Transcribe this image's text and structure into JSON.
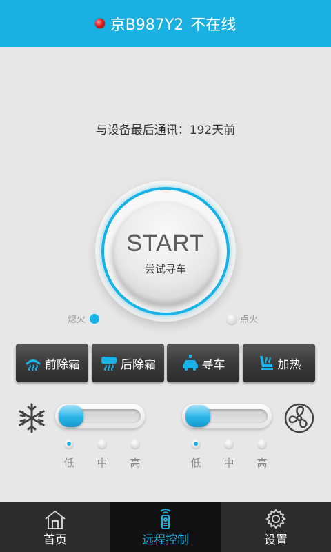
{
  "header": {
    "vehicle_plate": "京B987Y2",
    "status_text": "不在线"
  },
  "last_comm": {
    "text": "与设备最后通讯：192天前"
  },
  "start": {
    "label": "START",
    "sub_label": "尝试寻车"
  },
  "ignition": {
    "off_label": "熄火",
    "on_label": "点火",
    "selected": "熄火"
  },
  "functions": [
    {
      "label": "前除霜",
      "icon": "front-defrost-icon"
    },
    {
      "label": "后除霜",
      "icon": "rear-defrost-icon"
    },
    {
      "label": "寻车",
      "icon": "find-car-icon"
    },
    {
      "label": "加热",
      "icon": "seat-heat-icon"
    }
  ],
  "climate": {
    "ac": {
      "icon": "snowflake-icon",
      "level": "低",
      "levels": [
        "低",
        "中",
        "高"
      ]
    },
    "fan": {
      "icon": "fan-icon",
      "level": "低",
      "levels": [
        "低",
        "中",
        "高"
      ]
    }
  },
  "nav": {
    "items": [
      {
        "label": "首页",
        "icon": "home-icon"
      },
      {
        "label": "远程控制",
        "icon": "remote-control-icon"
      },
      {
        "label": "设置",
        "icon": "gear-icon"
      }
    ],
    "active": "远程控制"
  },
  "colors": {
    "accent": "#1ab0e2",
    "header_bg": "#1ab0e2",
    "nav_bg": "#2c2c2c",
    "status_dot": "#e21b1b"
  }
}
